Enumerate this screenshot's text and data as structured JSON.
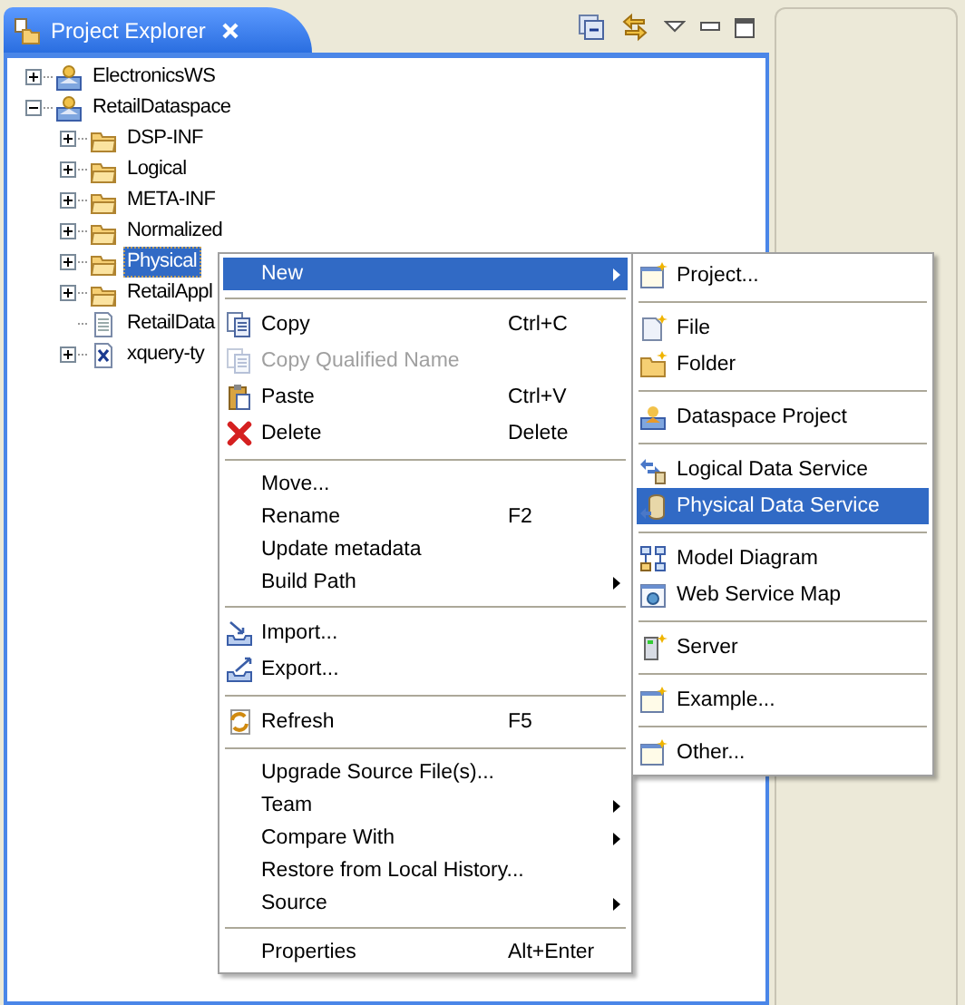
{
  "view": {
    "title": "Project Explorer"
  },
  "tree": [
    {
      "label": "ElectronicsWS",
      "kind": "project",
      "expanded": false,
      "selected": false
    },
    {
      "label": "RetailDataspace",
      "kind": "project",
      "expanded": true,
      "selected": false,
      "children": [
        {
          "label": "DSP-INF",
          "kind": "folder",
          "expanded": false,
          "selected": false
        },
        {
          "label": "Logical",
          "kind": "folder",
          "expanded": false,
          "selected": false
        },
        {
          "label": "META-INF",
          "kind": "folder",
          "expanded": false,
          "selected": false
        },
        {
          "label": "Normalized",
          "kind": "folder",
          "expanded": false,
          "selected": false
        },
        {
          "label": "Physical",
          "kind": "folder",
          "expanded": false,
          "selected": true
        },
        {
          "label": "RetailAppl",
          "kind": "folder",
          "expanded": false,
          "selected": false
        },
        {
          "label": "RetailData",
          "kind": "file",
          "selected": false
        },
        {
          "label": "xquery-ty",
          "kind": "xquery",
          "expanded": false,
          "selected": false
        }
      ]
    }
  ],
  "context_menu": [
    {
      "kind": "item",
      "label": "New",
      "submenu": true,
      "selected": true,
      "disabled": false
    },
    {
      "kind": "separator"
    },
    {
      "kind": "item",
      "label": "Copy",
      "shortcut": "Ctrl+C",
      "submenu": false,
      "selected": false,
      "disabled": false
    },
    {
      "kind": "item",
      "label": "Copy Qualified Name",
      "submenu": false,
      "selected": false,
      "disabled": true
    },
    {
      "kind": "item",
      "label": "Paste",
      "shortcut": "Ctrl+V",
      "submenu": false,
      "selected": false,
      "disabled": false
    },
    {
      "kind": "item",
      "label": "Delete",
      "shortcut": "Delete",
      "submenu": false,
      "selected": false,
      "disabled": false
    },
    {
      "kind": "separator"
    },
    {
      "kind": "item",
      "label": "Move...",
      "submenu": false,
      "selected": false,
      "disabled": false
    },
    {
      "kind": "item",
      "label": "Rename",
      "shortcut": "F2",
      "submenu": false,
      "selected": false,
      "disabled": false
    },
    {
      "kind": "item",
      "label": "Update metadata",
      "submenu": false,
      "selected": false,
      "disabled": false
    },
    {
      "kind": "item",
      "label": "Build Path",
      "submenu": true,
      "selected": false,
      "disabled": false
    },
    {
      "kind": "separator"
    },
    {
      "kind": "item",
      "label": "Import...",
      "submenu": false,
      "selected": false,
      "disabled": false
    },
    {
      "kind": "item",
      "label": "Export...",
      "submenu": false,
      "selected": false,
      "disabled": false
    },
    {
      "kind": "separator"
    },
    {
      "kind": "item",
      "label": "Refresh",
      "shortcut": "F5",
      "submenu": false,
      "selected": false,
      "disabled": false
    },
    {
      "kind": "separator"
    },
    {
      "kind": "item",
      "label": "Upgrade Source File(s)...",
      "submenu": false,
      "selected": false,
      "disabled": false
    },
    {
      "kind": "item",
      "label": "Team",
      "submenu": true,
      "selected": false,
      "disabled": false
    },
    {
      "kind": "item",
      "label": "Compare With",
      "submenu": true,
      "selected": false,
      "disabled": false
    },
    {
      "kind": "item",
      "label": "Restore from Local History...",
      "submenu": false,
      "selected": false,
      "disabled": false
    },
    {
      "kind": "item",
      "label": "Source",
      "submenu": true,
      "selected": false,
      "disabled": false
    },
    {
      "kind": "separator"
    },
    {
      "kind": "item",
      "label": "Properties",
      "shortcut": "Alt+Enter",
      "submenu": false,
      "selected": false,
      "disabled": false
    }
  ],
  "new_submenu": [
    {
      "kind": "item",
      "label": "Project...",
      "selected": false
    },
    {
      "kind": "separator"
    },
    {
      "kind": "item",
      "label": "File",
      "selected": false
    },
    {
      "kind": "item",
      "label": "Folder",
      "selected": false
    },
    {
      "kind": "separator"
    },
    {
      "kind": "item",
      "label": "Dataspace Project",
      "selected": false
    },
    {
      "kind": "separator"
    },
    {
      "kind": "item",
      "label": "Logical Data Service",
      "selected": false
    },
    {
      "kind": "item",
      "label": "Physical Data Service",
      "selected": true
    },
    {
      "kind": "separator"
    },
    {
      "kind": "item",
      "label": "Model Diagram",
      "selected": false
    },
    {
      "kind": "item",
      "label": "Web Service Map",
      "selected": false
    },
    {
      "kind": "separator"
    },
    {
      "kind": "item",
      "label": "Server",
      "selected": false
    },
    {
      "kind": "separator"
    },
    {
      "kind": "item",
      "label": "Example...",
      "selected": false
    },
    {
      "kind": "separator"
    },
    {
      "kind": "item",
      "label": "Other...",
      "selected": false
    }
  ]
}
